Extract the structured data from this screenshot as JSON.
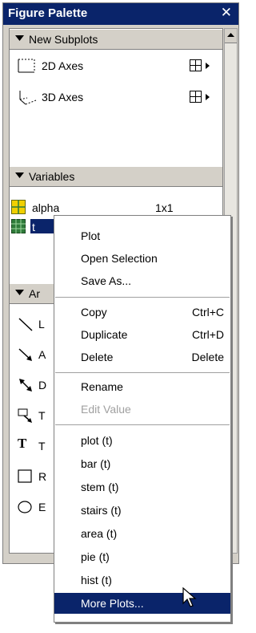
{
  "palette": {
    "title": "Figure Palette",
    "close_glyph": "✕"
  },
  "new_subplots": {
    "header": "New Subplots",
    "items": [
      {
        "label": "2D Axes"
      },
      {
        "label": "3D Axes"
      }
    ]
  },
  "variables": {
    "header": "Variables",
    "items": [
      {
        "label": "alpha",
        "size": "1x1"
      },
      {
        "label": "t",
        "selected": true
      }
    ]
  },
  "annotations": {
    "header_partial": "Ar",
    "items": [
      {
        "letter": "L",
        "icon": "line-icon"
      },
      {
        "letter": "A",
        "icon": "arrow-icon"
      },
      {
        "letter": "D",
        "icon": "double-arrow-icon"
      },
      {
        "letter": "T",
        "icon": "text-arrow-icon"
      },
      {
        "letter": "T",
        "icon": "textbox-icon"
      },
      {
        "letter": "R",
        "icon": "rectangle-icon"
      },
      {
        "letter": "E",
        "icon": "ellipse-icon"
      }
    ]
  },
  "context_menu": {
    "items": [
      {
        "label": "Plot",
        "shortcut": ""
      },
      {
        "label": "Open Selection",
        "shortcut": ""
      },
      {
        "label": "Save As...",
        "shortcut": ""
      },
      {
        "label": "Copy",
        "shortcut": "Ctrl+C"
      },
      {
        "label": "Duplicate",
        "shortcut": "Ctrl+D"
      },
      {
        "label": "Delete",
        "shortcut": "Delete"
      },
      {
        "label": "Rename",
        "shortcut": ""
      },
      {
        "label": "Edit Value",
        "shortcut": "",
        "disabled": true
      },
      {
        "label": "plot (t)",
        "shortcut": ""
      },
      {
        "label": "bar (t)",
        "shortcut": ""
      },
      {
        "label": "stem (t)",
        "shortcut": ""
      },
      {
        "label": "stairs (t)",
        "shortcut": ""
      },
      {
        "label": "area (t)",
        "shortcut": ""
      },
      {
        "label": "pie (t)",
        "shortcut": ""
      },
      {
        "label": "hist (t)",
        "shortcut": ""
      },
      {
        "label": "More Plots...",
        "shortcut": "",
        "selected": true
      }
    ]
  },
  "colors": {
    "title_bg": "#0a246a",
    "panel_bg": "#d4d0c8",
    "selection": "#0a246a",
    "var_icon_yellow": "#f0d000",
    "var_icon_green": "#2f7b3a"
  }
}
